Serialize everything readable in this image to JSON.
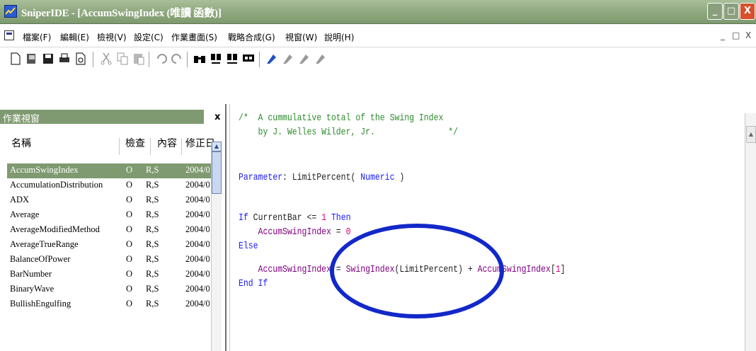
{
  "window": {
    "title": "SniperIDE - [AccumSwingIndex (唯讀 函數)]",
    "min_label": "_",
    "max_label": "□",
    "close_label": "X"
  },
  "menu": {
    "items": [
      "檔案(F)",
      "編輯(E)",
      "檢視(V)",
      "設定(C)",
      "作業畫面(S)",
      "戰略合成(G)",
      "視窗(W)",
      "說明(H)"
    ],
    "mdi_min": "_",
    "mdi_max": "□",
    "mdi_close": "X"
  },
  "toolbar": {
    "icons": [
      "new-file-icon",
      "open-icon",
      "save-icon",
      "print-icon",
      "print-preview-icon",
      "cut-icon",
      "copy-icon",
      "paste-icon",
      "undo-icon",
      "redo-icon",
      "find-icon",
      "find-next-icon",
      "replace-icon",
      "bookmark-icon",
      "verify-icon",
      "compile-icon",
      "build-icon",
      "stop-icon"
    ]
  },
  "panel": {
    "title": "作業視窗",
    "close": "x",
    "columns": [
      "名稱",
      "檢查",
      "內容",
      "修正日"
    ],
    "rows": [
      {
        "name": "AccumSwingIndex",
        "check": "O",
        "content": "R,S",
        "date": "2004/0"
      },
      {
        "name": "AccumulationDistribution",
        "check": "O",
        "content": "R,S",
        "date": "2004/0"
      },
      {
        "name": "ADX",
        "check": "O",
        "content": "R,S",
        "date": "2004/0"
      },
      {
        "name": "Average",
        "check": "O",
        "content": "R,S",
        "date": "2004/0"
      },
      {
        "name": "AverageModifiedMethod",
        "check": "O",
        "content": "R,S",
        "date": "2004/0"
      },
      {
        "name": "AverageTrueRange",
        "check": "O",
        "content": "R,S",
        "date": "2004/0"
      },
      {
        "name": "BalanceOfPower",
        "check": "O",
        "content": "R,S",
        "date": "2004/0"
      },
      {
        "name": "BarNumber",
        "check": "O",
        "content": "R,S",
        "date": "2004/0"
      },
      {
        "name": "BinaryWave",
        "check": "O",
        "content": "R,S",
        "date": "2004/0"
      },
      {
        "name": "BullishEngulfing",
        "check": "O",
        "content": "R,S",
        "date": "2004/0"
      }
    ]
  },
  "editor": {
    "line1a": "/*  A cummulative total of the Swing Index",
    "line2a": "    by J. Welles Wilder, Jr.               */",
    "param_kw": "Parameter",
    "param_rest": ": LimitPercent( ",
    "param_type": "Numeric",
    "param_end": " )",
    "if_kw": "If",
    "if_mid": " CurrentBar <= ",
    "if_num": "1",
    "if_then": " Then",
    "assign1": "AccumSwingIndex",
    "assign1_mid": " = ",
    "assign1_val": "0",
    "else_kw": "Else",
    "assign2": "AccumSwingIndex",
    "assign2_mid": " = ",
    "assign2_fn": "SwingIndex",
    "assign2_arg": "(LimitPercent) + ",
    "assign2_ref": "AccumSwingIndex",
    "assign2_idx_open": "[",
    "assign2_idx": "1",
    "assign2_idx_close": "]",
    "endif_kw": "End If"
  },
  "colors": {
    "title_bg": "#92ab82",
    "selection": "#7f9a70",
    "comment": "#2e8b2e",
    "keyword": "#1a1aff",
    "identifier": "#800080",
    "number": "#e0007a",
    "highlight_ring": "#1228c8"
  }
}
